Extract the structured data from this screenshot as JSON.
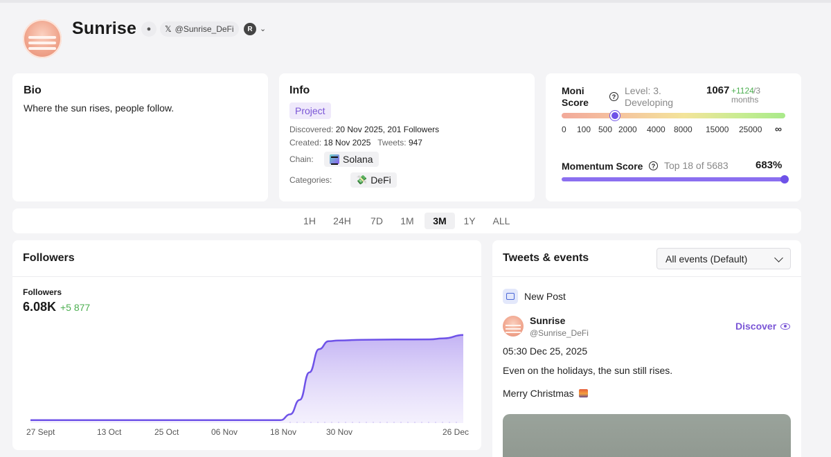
{
  "profile": {
    "name": "Sunrise",
    "handle": "@Sunrise_DeFi",
    "globe_icon": "globe-icon",
    "x_icon": "x-logo-icon",
    "r_badge": "R"
  },
  "bio": {
    "title": "Bio",
    "text": "Where the sun rises, people follow."
  },
  "info": {
    "title": "Info",
    "tag": "Project",
    "discovered_label": "Discovered:",
    "discovered_value": "20 Nov 2025, 201 Followers",
    "created_label": "Created:",
    "created_value": "18 Nov 2025",
    "tweets_label": "Tweets:",
    "tweets_value": "947",
    "chain_label": "Chain:",
    "chain_value": "Solana",
    "categories_label": "Categories:",
    "category_value": "DeFi",
    "category_icon": "💸"
  },
  "moni": {
    "title_line1": "Moni",
    "title_line2": "Score",
    "level_line1": "Level: 3.",
    "level_line2": "Developing",
    "score": "1067",
    "delta": "+1124",
    "period_suffix": "/3",
    "period_line2": "months",
    "ticks": [
      "0",
      "100",
      "500",
      "2000",
      "4000",
      "8000",
      "15000",
      "25000",
      "∞"
    ],
    "momentum_title": "Momentum Score",
    "momentum_rank": "Top 18 of 5683",
    "momentum_pct": "683%"
  },
  "timeframes": {
    "items": [
      "1H",
      "24H",
      "7D",
      "1M",
      "3M",
      "1Y",
      "ALL"
    ],
    "active": "3M"
  },
  "followers": {
    "title": "Followers",
    "label": "Followers",
    "value": "6.08K",
    "delta": "+5 877"
  },
  "chart_data": {
    "type": "area",
    "title": "Followers",
    "xlabel": "",
    "ylabel": "",
    "x_tick_labels": [
      "27 Sept",
      "13 Oct",
      "25 Oct",
      "06 Nov",
      "18 Nov",
      "30 Nov",
      "26 Dec"
    ],
    "x": [
      "27 Sept",
      "18 Nov",
      "20 Nov",
      "22 Nov",
      "24 Nov",
      "26 Nov",
      "28 Nov",
      "30 Nov",
      "05 Dec",
      "12 Dec",
      "19 Dec",
      "22 Dec",
      "26 Dec"
    ],
    "series": [
      {
        "values": [
          201,
          201,
          600,
          1600,
          3500,
          5100,
          5650,
          5700,
          5750,
          5770,
          5780,
          5850,
          6078
        ]
      }
    ],
    "ylim": [
      0,
      6500
    ],
    "grid": false,
    "color": "#6e52e8"
  },
  "tweets": {
    "title": "Tweets & events",
    "filter": "All events (Default)",
    "event_type": "New Post",
    "author": "Sunrise",
    "author_handle": "@Sunrise_DeFi",
    "discover": "Discover",
    "time": "05:30 Dec 25, 2025",
    "text": "Even on the holidays, the sun still rises.",
    "text2": "Merry Christmas"
  },
  "colors": {
    "accent": "#7a55d6",
    "knob": "#6e52e8",
    "positive": "#4caf50"
  }
}
